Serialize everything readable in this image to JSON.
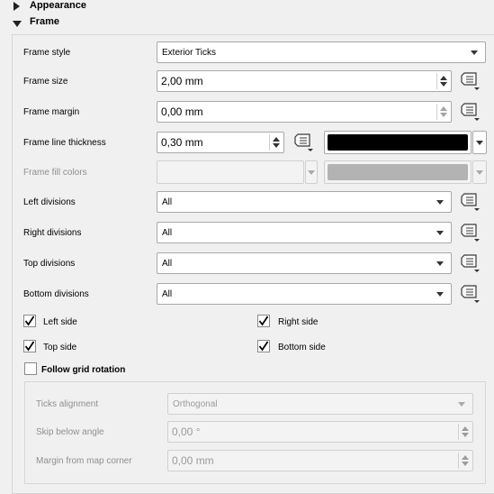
{
  "sections": {
    "appearance": "Appearance",
    "frame": "Frame"
  },
  "frame_style": {
    "label": "Frame style",
    "value": "Exterior Ticks"
  },
  "frame_size": {
    "label": "Frame size",
    "value": "2,00 mm"
  },
  "frame_margin": {
    "label": "Frame margin",
    "value": "0,00 mm"
  },
  "frame_line_thickness": {
    "label": "Frame line thickness",
    "value": "0,30 mm",
    "color": "#000000"
  },
  "frame_fill_colors": {
    "label": "Frame fill colors",
    "color1": "#ffffff",
    "color2": "#b3b3b3"
  },
  "left_divisions": {
    "label": "Left divisions",
    "value": "All"
  },
  "right_divisions": {
    "label": "Right divisions",
    "value": "All"
  },
  "top_divisions": {
    "label": "Top divisions",
    "value": "All"
  },
  "bottom_divisions": {
    "label": "Bottom divisions",
    "value": "All"
  },
  "checkboxes": {
    "left_side": "Left side",
    "right_side": "Right side",
    "top_side": "Top side",
    "bottom_side": "Bottom side",
    "follow_grid_rotation": "Follow grid rotation"
  },
  "ticks": {
    "alignment_label": "Ticks alignment",
    "alignment_value": "Orthogonal",
    "skip_label": "Skip below angle",
    "skip_value": "0,00 °",
    "margin_label": "Margin from map corner",
    "margin_value": "0,00 mm"
  }
}
